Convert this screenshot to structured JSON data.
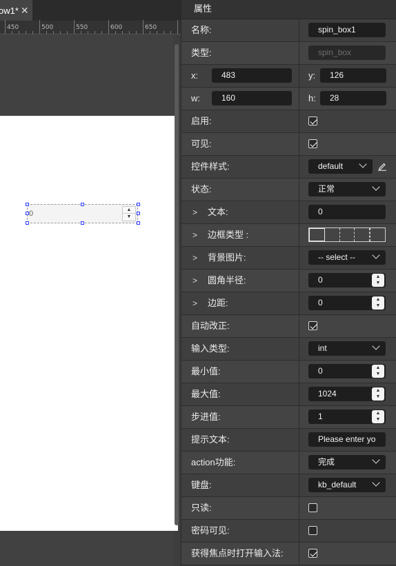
{
  "tab": {
    "title": "ow1*",
    "close_glyph": "✕"
  },
  "ruler": {
    "labels": [
      "450",
      "500",
      "550",
      "600",
      "650"
    ]
  },
  "widget": {
    "value": "0",
    "up_glyph": "▲",
    "down_glyph": "▼"
  },
  "panel": {
    "title": "属性",
    "rows": {
      "name": {
        "label": "名称:",
        "value": "spin_box1"
      },
      "type": {
        "label": "类型:",
        "value": "spin_box"
      },
      "xy": {
        "x_label": "x:",
        "x_value": "483",
        "y_label": "y:",
        "y_value": "126"
      },
      "wh": {
        "w_label": "w:",
        "w_value": "160",
        "h_label": "h:",
        "h_value": "28"
      },
      "enable": {
        "label": "启用:",
        "checked": true
      },
      "visible": {
        "label": "可见:",
        "checked": true
      },
      "style": {
        "label": "控件样式:",
        "value": "default"
      },
      "state": {
        "label": "状态:",
        "value": "正常"
      },
      "text": {
        "label": "文本:",
        "value": "0"
      },
      "border_type": {
        "label": "边框类型 :"
      },
      "bg_image": {
        "label": "背景图片:",
        "value": "-- select --"
      },
      "radius": {
        "label": "圆角半径:",
        "value": "0"
      },
      "margin": {
        "label": "边距:",
        "value": "0"
      },
      "auto_fix": {
        "label": "自动改正:",
        "checked": true
      },
      "input_type": {
        "label": "输入类型:",
        "value": "int"
      },
      "min": {
        "label": "最小值:",
        "value": "0"
      },
      "max": {
        "label": "最大值:",
        "value": "1024"
      },
      "step": {
        "label": "步进值:",
        "value": "1"
      },
      "tips": {
        "label": "提示文本:",
        "value": "Please enter yo"
      },
      "action": {
        "label": "action功能:",
        "value": "完成"
      },
      "keyboard": {
        "label": "键盘:",
        "value": "kb_default"
      },
      "readonly": {
        "label": "只读:",
        "checked": false
      },
      "password_visible": {
        "label": "密码可见:",
        "checked": false
      },
      "open_im": {
        "label": "获得焦点时打开输入法:",
        "checked": true
      }
    },
    "chevron_glyph": ">",
    "stepper_up": "▲",
    "stepper_down": "▼"
  }
}
